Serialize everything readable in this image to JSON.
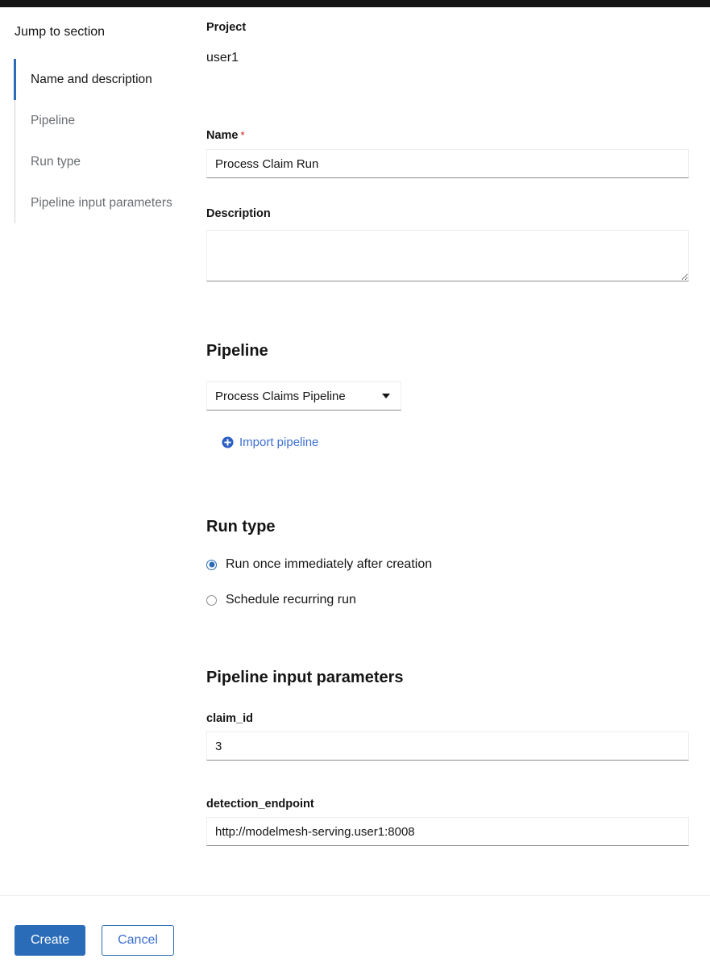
{
  "topbar": {
    "color": "#151515"
  },
  "jump_to_section": {
    "title": "Jump to section",
    "items": [
      {
        "label": "Name and description",
        "active": true
      },
      {
        "label": "Pipeline",
        "active": false
      },
      {
        "label": "Run type",
        "active": false
      },
      {
        "label": "Pipeline input parameters",
        "active": false
      }
    ]
  },
  "form": {
    "project": {
      "label": "Project",
      "value": "user1"
    },
    "name": {
      "label": "Name",
      "required_marker": "*",
      "value": "Process Claim Run",
      "placeholder": ""
    },
    "description": {
      "label": "Description",
      "value": "",
      "placeholder": ""
    },
    "pipeline_section": {
      "heading": "Pipeline",
      "selected": "Process Claims Pipeline",
      "caret_icon": "chevron-down-icon",
      "import_link": {
        "label": "Import pipeline",
        "icon": "plus-circle-icon"
      }
    },
    "run_type": {
      "heading": "Run type",
      "options": [
        {
          "label": "Run once immediately after creation",
          "selected": true
        },
        {
          "label": "Schedule recurring run",
          "selected": false
        }
      ]
    },
    "input_parameters": {
      "heading": "Pipeline input parameters",
      "fields": [
        {
          "label": "claim_id",
          "value": "3"
        },
        {
          "label": "detection_endpoint",
          "value": "http://modelmesh-serving.user1:8008"
        }
      ]
    }
  },
  "footer": {
    "create_label": "Create",
    "cancel_label": "Cancel"
  },
  "colors": {
    "accent_blue": "#2b6cb8",
    "link_blue": "#3c6fd1",
    "required_red": "#c9190b",
    "muted_text": "#6a6e73",
    "text": "#151515"
  }
}
